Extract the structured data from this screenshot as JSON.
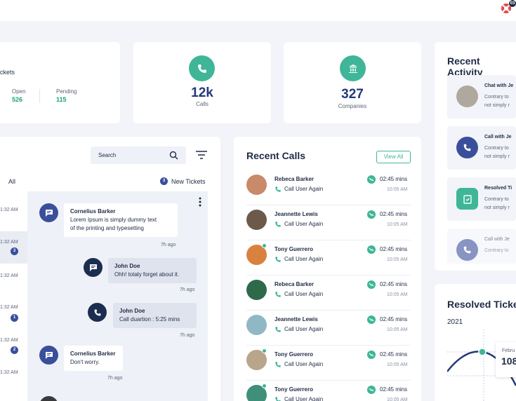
{
  "header": {
    "help_badge": "03"
  },
  "tickets_summary": {
    "title_partial": "ckets",
    "open_label": "Open",
    "open_value": "526",
    "pending_label": "Pending",
    "pending_value": "115"
  },
  "stats": [
    {
      "value": "12k",
      "caption": "Calls",
      "icon": "phone-icon"
    },
    {
      "value": "327",
      "caption": "Companies",
      "icon": "bank-icon"
    }
  ],
  "chat": {
    "search_placeholder": "Search",
    "filter_all": "All",
    "new_tickets_count": "3",
    "new_tickets_label": "New Tickets",
    "list_times": [
      "1:32 AM",
      "1:32 AM",
      "1:32 AM",
      "1:32 AM",
      "1:32 AM",
      "1:32 AM"
    ],
    "list_badges": [
      "3",
      "1",
      "2"
    ],
    "messages": [
      {
        "name": "Cornelius Barker",
        "text1": "Lorem Ipsum is simply dummy text",
        "text2": "of the printing and typesetting",
        "ago": "7h ago"
      },
      {
        "name": "John Doe",
        "text1": "Ohh! totaly forget about it.",
        "ago": "7h ago"
      },
      {
        "name": "John Doe",
        "text1": "Call duartion : 5:25 mins",
        "ago": "7h ago"
      },
      {
        "name": "Cornelius Barker",
        "text1": "Don't worry.",
        "ago": "7h ago"
      }
    ]
  },
  "recent_calls": {
    "title": "Recent Calls",
    "view_all": "View All",
    "rows": [
      {
        "name": "Rebeca Barker",
        "action": "Call User Again",
        "duration": "02:45 mins",
        "time": "10:05 AM",
        "avatar_color": "#c98a6a"
      },
      {
        "name": "Jeannette Lewis",
        "action": "Call User Again",
        "duration": "02:45 mins",
        "time": "10:05 AM",
        "avatar_color": "#6b5a4c"
      },
      {
        "name": "Tony Guerrero",
        "action": "Call User Again",
        "duration": "02:45 mins",
        "time": "10:05 AM",
        "avatar_color": "#d9823f"
      },
      {
        "name": "Rebeca Barker",
        "action": "Call User Again",
        "duration": "02:45 mins",
        "time": "10:05 AM",
        "avatar_color": "#2e6a4a"
      },
      {
        "name": "Jeannette Lewis",
        "action": "Call User Again",
        "duration": "02:45 mins",
        "time": "10:05 AM",
        "avatar_color": "#8fb8c4"
      },
      {
        "name": "Tony Guerrero",
        "action": "Call User Again",
        "duration": "02:45 mins",
        "time": "10:05 AM",
        "avatar_color": "#b9a48c"
      },
      {
        "name": "Tony Guerrero",
        "action": "Call User Again",
        "duration": "02:45 mins",
        "time": "10:05 AM",
        "avatar_color": "#3f8f7a"
      }
    ]
  },
  "recent_activity": {
    "title": "Recent Activity",
    "items": [
      {
        "title": "Chat with Je",
        "line1": "Contrary to",
        "line2": "not simply r"
      },
      {
        "title": "Call with Je",
        "line1": "Contrary to",
        "line2": "not simply r"
      },
      {
        "title": "Resolved Ti",
        "line1": "Contrary to",
        "line2": "not simply r"
      },
      {
        "title": "Call with Je",
        "line1": "Contrary to",
        "line2": ""
      }
    ]
  },
  "resolved_tickets": {
    "title": "Resolved Tickets",
    "year": "2021",
    "tooltip_month": "Febru",
    "tooltip_value": "108"
  },
  "colors": {
    "accent": "#3eb697",
    "primary": "#3a4f9c",
    "text": "#1f2a44"
  }
}
